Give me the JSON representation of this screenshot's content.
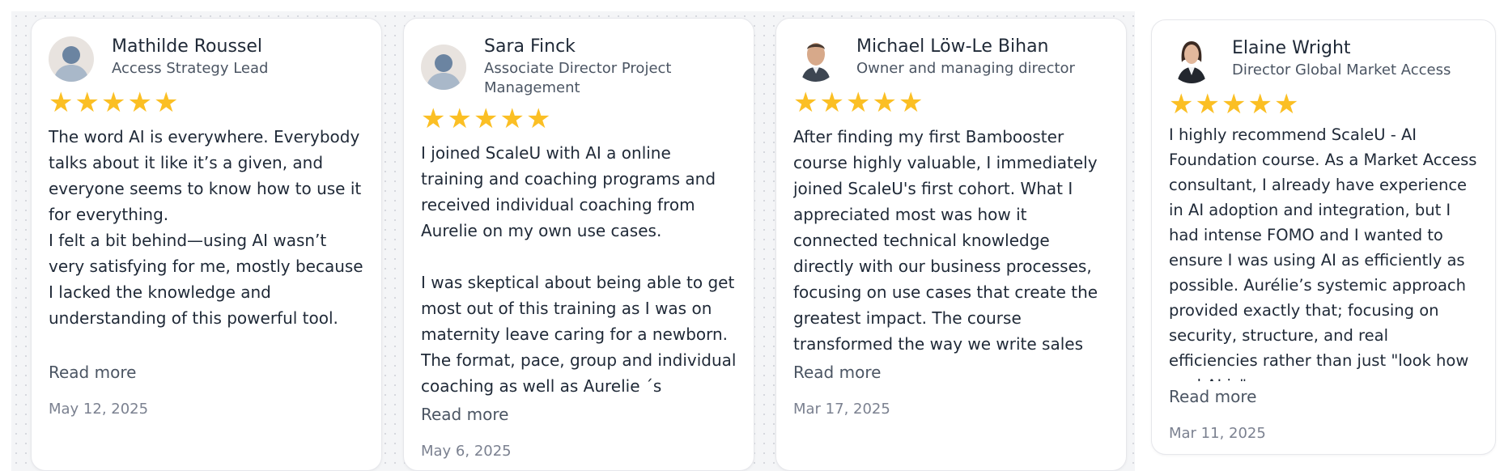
{
  "reviews": [
    {
      "avatar_icon": "default-user-icon",
      "name": "Mathilde Roussel",
      "role": "Access Strategy Lead",
      "rating": 5,
      "text": "The word AI is everywhere. Everybody talks about it like it’s a given, and everyone seems to know how to use it for everything.\nI felt a bit behind—using AI wasn’t very satisfying for me, mostly because I lacked the knowledge and understanding of this powerful tool.\n\nScaleU was amazing at elevating my...",
      "read_more": "Read more",
      "date": "May 12, 2025"
    },
    {
      "avatar_icon": "default-user-icon",
      "name": "Sara Finck",
      "role": "Associate Director Project Management",
      "rating": 5,
      "text": "I joined ScaleU with AI a online training and coaching programs and received individual coaching from Aurelie on my own use cases.\n\nI was skeptical about being able to get most out of this training as I was on maternity leave caring for a newborn. The format, pace, group and individual coaching as well as Aurelie ´s expertise...",
      "read_more": "Read more",
      "date": "May 6, 2025"
    },
    {
      "avatar_icon": "man-photo-icon",
      "name": "Michael Löw-Le Bihan",
      "role": "Owner and managing director",
      "rating": 5,
      "text": "After finding my first Bambooster course highly valuable, I immediately joined ScaleU's first cohort. What I appreciated most was how it connected technical knowledge directly with our business processes, focusing on use cases that create the greatest impact. The course transformed the way we write sales proposals and also how we conduct inventories of natural assets. For the...",
      "read_more": "Read more",
      "date": "Mar 17, 2025"
    },
    {
      "avatar_icon": "woman-photo-icon",
      "name": "Elaine Wright",
      "role": "Director Global Market Access",
      "rating": 5,
      "text": "I highly recommend ScaleU - AI Foundation course. As a Market Access consultant, I already have experience in AI adoption and integration, but I had intense FOMO and I wanted to ensure I was using AI as efficiently as possible. Aurélie’s systemic approach provided exactly that; focusing on security, structure, and real efficiencies rather than just \"look how cool AI is\"....",
      "read_more": "Read more",
      "date": "Mar 11, 2025"
    }
  ],
  "colors": {
    "star": "#fbbf24",
    "text": "#1f2937",
    "muted": "#7b8190"
  }
}
